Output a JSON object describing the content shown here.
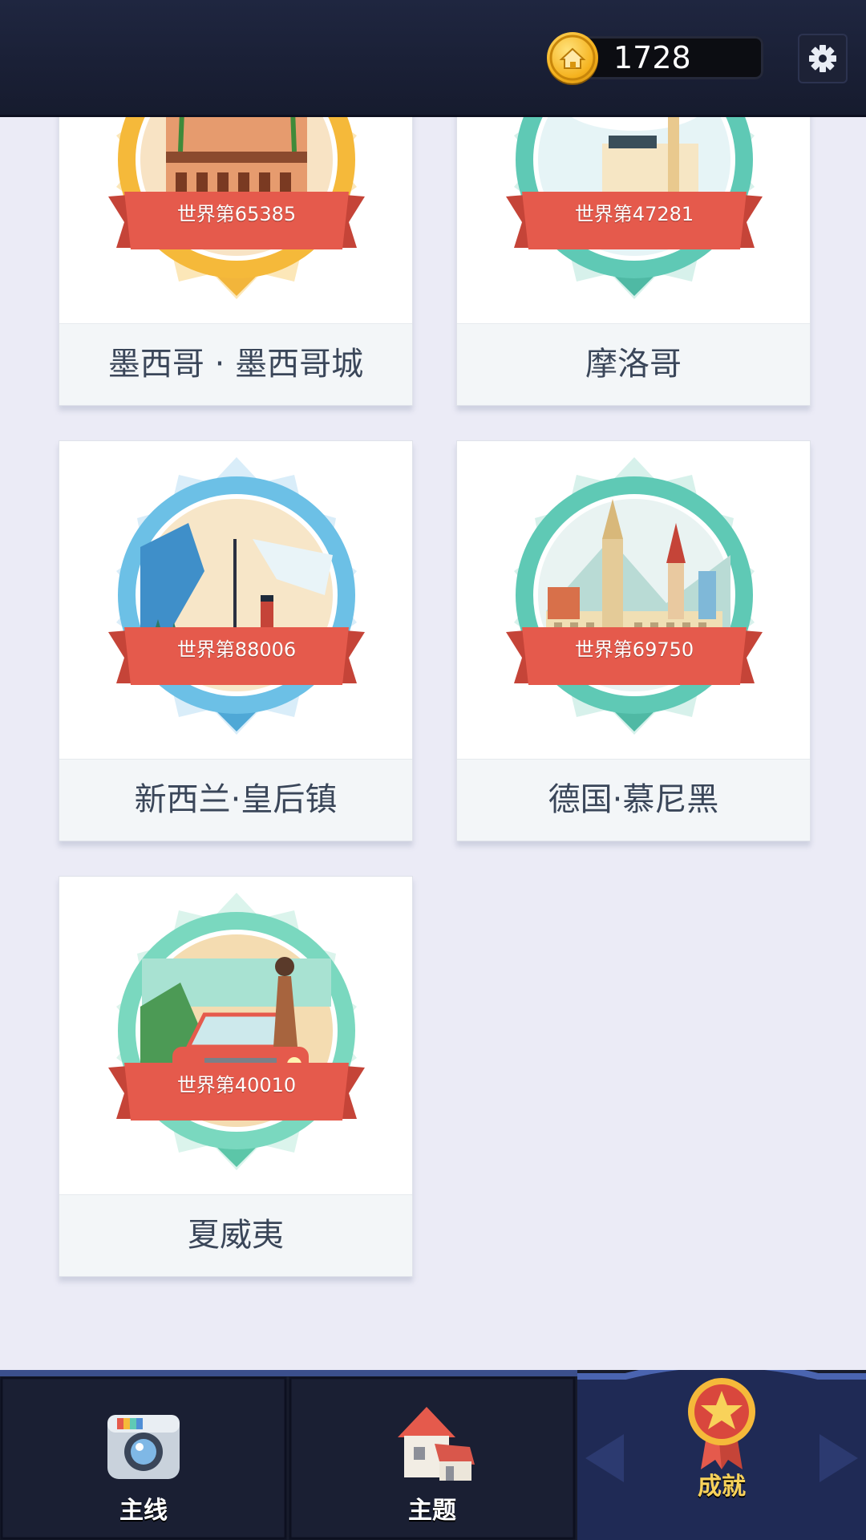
{
  "header": {
    "coins": "1728",
    "coin_icon": "gold-coin-house-icon",
    "settings_icon": "gear-icon"
  },
  "cards": [
    {
      "name": "墨西哥 · 墨西哥城",
      "rank": "世界第65385",
      "theme": "gold",
      "scene": "palace-with-palm-trees"
    },
    {
      "name": "摩洛哥",
      "rank": "世界第47281",
      "theme": "teal",
      "scene": "seaside-town-with-sailboats"
    },
    {
      "name": "新西兰·皇后镇",
      "rank": "世界第88006",
      "theme": "blue",
      "scene": "lake-steamboat-and-mountains"
    },
    {
      "name": "德国·慕尼黑",
      "rank": "世界第69750",
      "theme": "teal",
      "scene": "gothic-town-hall-and-churches"
    },
    {
      "name": "夏威夷",
      "rank": "世界第40010",
      "theme": "mint",
      "scene": "beach-car-and-woman"
    }
  ],
  "nav": {
    "tabs": [
      {
        "label": "主线",
        "icon": "camera-icon",
        "active": false
      },
      {
        "label": "主题",
        "icon": "house-icon",
        "active": false
      },
      {
        "label": "成就",
        "icon": "star-medal-icon",
        "active": true
      }
    ]
  },
  "colors": {
    "header_bg": "#1b2138",
    "page_bg": "#ebebf6",
    "ribbon": "#e55a4c",
    "gold": "#f5b93a",
    "teal": "#5fc9b5",
    "blue": "#6cc0e6",
    "mint": "#7ad8bf",
    "active_label": "#f8d25a"
  }
}
